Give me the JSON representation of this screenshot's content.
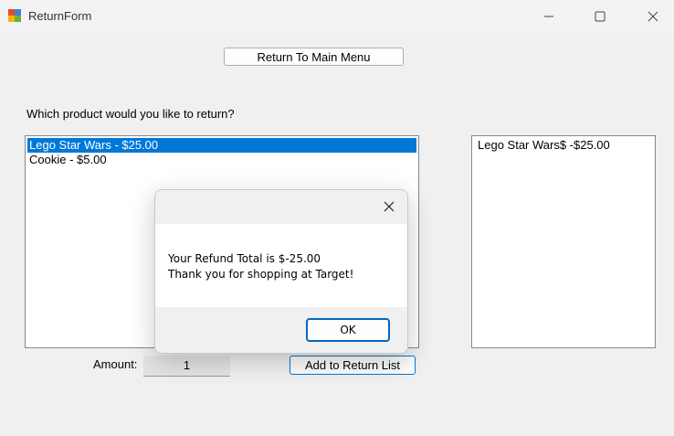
{
  "window": {
    "title": "ReturnForm",
    "icon": "winforms-app-icon",
    "controls": [
      "minimize-icon",
      "maximize-icon",
      "close-icon"
    ]
  },
  "form": {
    "main_menu_label": "Return To Main Menu",
    "prompt": "Which product would you like to return?",
    "products": [
      {
        "label": "Lego Star Wars - $25.00",
        "selected": true
      },
      {
        "label": "Cookie - $5.00",
        "selected": false
      }
    ],
    "return_list": [
      {
        "label": "Lego Star Wars$ -$25.00"
      }
    ],
    "amount_label": "Amount:",
    "amount_value": "1",
    "add_button_label": "Add to Return List"
  },
  "dialog": {
    "message_line1": "Your Refund Total is $-25.00",
    "message_line2": "Thank you for shopping at Target!",
    "ok_label": "OK"
  },
  "colors": {
    "selection": "#0078d7",
    "focus_border": "#0067c0"
  }
}
